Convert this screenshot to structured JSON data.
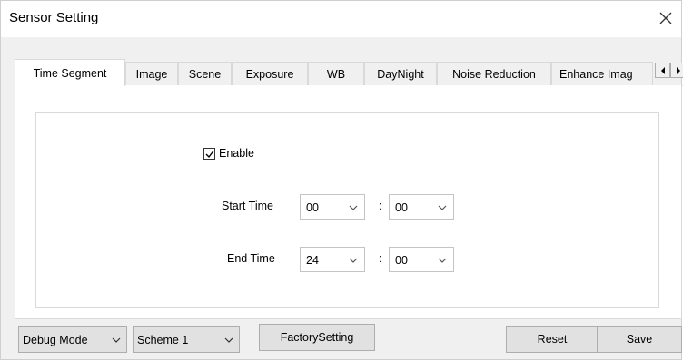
{
  "window": {
    "title": "Sensor Setting"
  },
  "tabs": [
    {
      "label": "Time Segment",
      "active": true
    },
    {
      "label": "Image"
    },
    {
      "label": "Scene"
    },
    {
      "label": "Exposure"
    },
    {
      "label": "WB"
    },
    {
      "label": "DayNight"
    },
    {
      "label": "Noise Reduction"
    },
    {
      "label": "Enhance Imag"
    }
  ],
  "time_segment": {
    "enable_label": "Enable",
    "enable_checked": true,
    "start_label": "Start Time",
    "start_hour": "00",
    "start_minute": "00",
    "end_label": "End Time",
    "end_hour": "24",
    "end_minute": "00",
    "separator": ":"
  },
  "footer": {
    "debug_mode": "Debug Mode",
    "scheme": "Scheme 1",
    "factory_label": "FactorySetting",
    "reset_label": "Reset",
    "save_label": "Save"
  },
  "icons": {
    "close": "close-icon",
    "tab_prev": "arrow-left-icon",
    "tab_next": "arrow-right-icon",
    "dropdown": "chevron-down-icon",
    "check": "check-icon"
  }
}
